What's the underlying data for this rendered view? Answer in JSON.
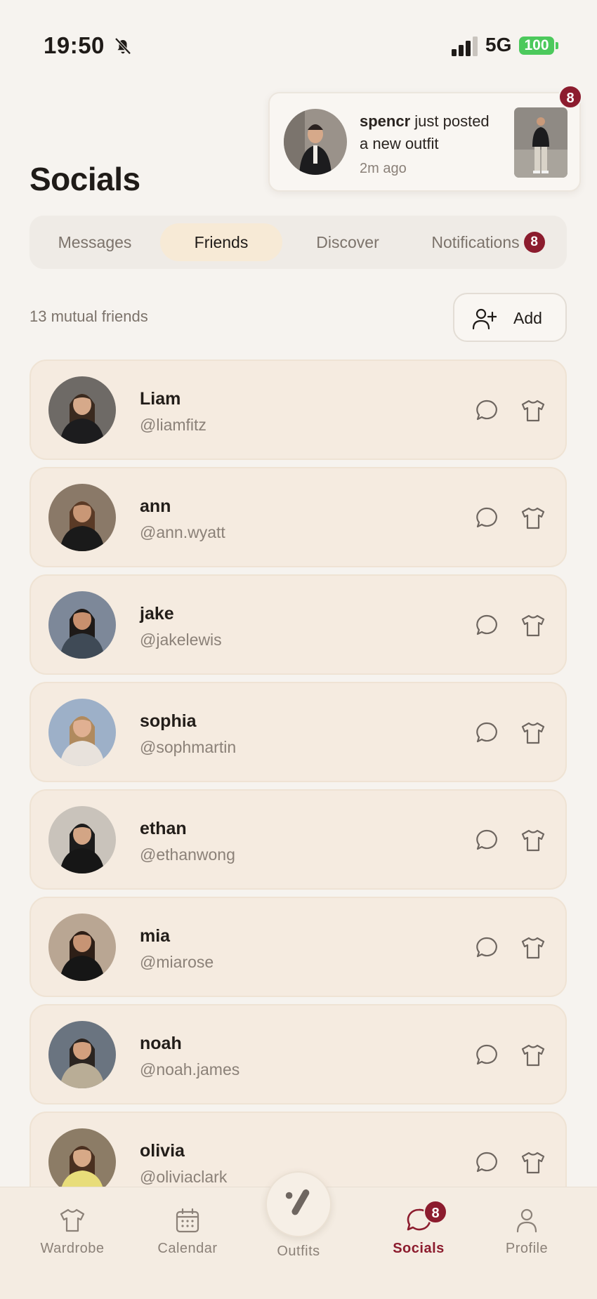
{
  "status_bar": {
    "time": "19:50",
    "network": "5G",
    "battery": "100",
    "icons": [
      "bell-slash-icon",
      "signal-bars-icon",
      "battery-icon"
    ]
  },
  "notification_card": {
    "username": "spencr",
    "message_line1": " just posted",
    "message_line2": "a new outfit",
    "time_ago": "2m ago",
    "badge_count": "8"
  },
  "header": {
    "title": "Socials"
  },
  "tabs": [
    {
      "label": "Messages",
      "active": false
    },
    {
      "label": "Friends",
      "active": true
    },
    {
      "label": "Discover",
      "active": false
    },
    {
      "label": "Notifications",
      "active": false,
      "badge": "8"
    }
  ],
  "friends_header": {
    "count_text": "13 mutual friends",
    "add_label": "Add"
  },
  "friends": [
    {
      "name": "Liam",
      "handle": "@liamfitz",
      "skin": "#d6a98a",
      "hair": "#3a2a1f",
      "clothes": "#1c1c1e",
      "bg": "#6e6a66"
    },
    {
      "name": "ann",
      "handle": "@ann.wyatt",
      "skin": "#c99776",
      "hair": "#5a3a26",
      "clothes": "#1a1a1a",
      "bg": "#8a7968"
    },
    {
      "name": "jake",
      "handle": "@jakelewis",
      "skin": "#c8906e",
      "hair": "#1e1a18",
      "clothes": "#3f4a56",
      "bg": "#7d8899"
    },
    {
      "name": "sophia",
      "handle": "@sophmartin",
      "skin": "#e0b092",
      "hair": "#b08a5e",
      "clothes": "#e8e2dc",
      "bg": "#9db0c8"
    },
    {
      "name": "ethan",
      "handle": "@ethanwong",
      "skin": "#d3a585",
      "hair": "#1c1c1c",
      "clothes": "#161616",
      "bg": "#c9c3bb"
    },
    {
      "name": "mia",
      "handle": "@miarose",
      "skin": "#c79474",
      "hair": "#2e1f17",
      "clothes": "#161616",
      "bg": "#b9a693"
    },
    {
      "name": "noah",
      "handle": "@noah.james",
      "skin": "#d2a07e",
      "hair": "#2a2420",
      "clothes": "#b9ad96",
      "bg": "#6a7480"
    },
    {
      "name": "olivia",
      "handle": "@oliviaclark",
      "skin": "#d7a987",
      "hair": "#4a3020",
      "clothes": "#e8dd7a",
      "bg": "#8c7c66"
    }
  ],
  "bottom_nav": [
    {
      "label": "Wardrobe",
      "icon": "shirt-icon",
      "active": false
    },
    {
      "label": "Calendar",
      "icon": "calendar-icon",
      "active": false
    },
    {
      "label": "Outfits",
      "icon": "outfits-logo-icon",
      "active": false
    },
    {
      "label": "Socials",
      "icon": "chat-bubble-icon",
      "active": true,
      "badge": "8"
    },
    {
      "label": "Profile",
      "icon": "person-icon",
      "active": false
    }
  ],
  "colors": {
    "accent": "#8c1c2e",
    "background": "#f6f3ef",
    "card": "#f5ebe0",
    "active_tab": "#f7ead6",
    "battery": "#4cc95c"
  }
}
